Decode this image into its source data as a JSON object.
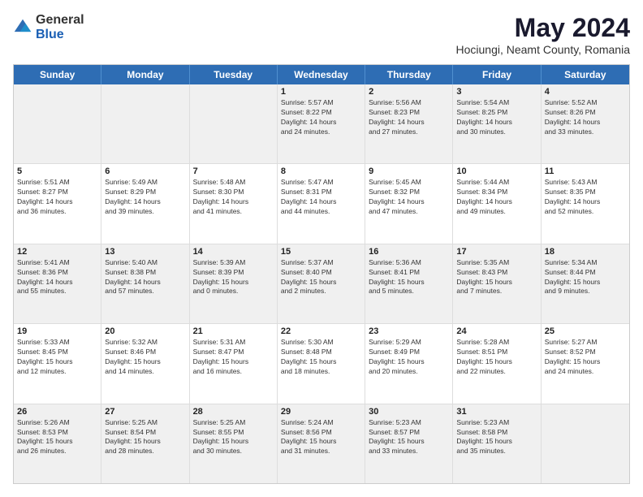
{
  "logo": {
    "general": "General",
    "blue": "Blue"
  },
  "header": {
    "month_year": "May 2024",
    "location": "Hociungi, Neamt County, Romania"
  },
  "weekdays": [
    "Sunday",
    "Monday",
    "Tuesday",
    "Wednesday",
    "Thursday",
    "Friday",
    "Saturday"
  ],
  "rows": [
    [
      {
        "day": "",
        "info": ""
      },
      {
        "day": "",
        "info": ""
      },
      {
        "day": "",
        "info": ""
      },
      {
        "day": "1",
        "info": "Sunrise: 5:57 AM\nSunset: 8:22 PM\nDaylight: 14 hours\nand 24 minutes."
      },
      {
        "day": "2",
        "info": "Sunrise: 5:56 AM\nSunset: 8:23 PM\nDaylight: 14 hours\nand 27 minutes."
      },
      {
        "day": "3",
        "info": "Sunrise: 5:54 AM\nSunset: 8:25 PM\nDaylight: 14 hours\nand 30 minutes."
      },
      {
        "day": "4",
        "info": "Sunrise: 5:52 AM\nSunset: 8:26 PM\nDaylight: 14 hours\nand 33 minutes."
      }
    ],
    [
      {
        "day": "5",
        "info": "Sunrise: 5:51 AM\nSunset: 8:27 PM\nDaylight: 14 hours\nand 36 minutes."
      },
      {
        "day": "6",
        "info": "Sunrise: 5:49 AM\nSunset: 8:29 PM\nDaylight: 14 hours\nand 39 minutes."
      },
      {
        "day": "7",
        "info": "Sunrise: 5:48 AM\nSunset: 8:30 PM\nDaylight: 14 hours\nand 41 minutes."
      },
      {
        "day": "8",
        "info": "Sunrise: 5:47 AM\nSunset: 8:31 PM\nDaylight: 14 hours\nand 44 minutes."
      },
      {
        "day": "9",
        "info": "Sunrise: 5:45 AM\nSunset: 8:32 PM\nDaylight: 14 hours\nand 47 minutes."
      },
      {
        "day": "10",
        "info": "Sunrise: 5:44 AM\nSunset: 8:34 PM\nDaylight: 14 hours\nand 49 minutes."
      },
      {
        "day": "11",
        "info": "Sunrise: 5:43 AM\nSunset: 8:35 PM\nDaylight: 14 hours\nand 52 minutes."
      }
    ],
    [
      {
        "day": "12",
        "info": "Sunrise: 5:41 AM\nSunset: 8:36 PM\nDaylight: 14 hours\nand 55 minutes."
      },
      {
        "day": "13",
        "info": "Sunrise: 5:40 AM\nSunset: 8:38 PM\nDaylight: 14 hours\nand 57 minutes."
      },
      {
        "day": "14",
        "info": "Sunrise: 5:39 AM\nSunset: 8:39 PM\nDaylight: 15 hours\nand 0 minutes."
      },
      {
        "day": "15",
        "info": "Sunrise: 5:37 AM\nSunset: 8:40 PM\nDaylight: 15 hours\nand 2 minutes."
      },
      {
        "day": "16",
        "info": "Sunrise: 5:36 AM\nSunset: 8:41 PM\nDaylight: 15 hours\nand 5 minutes."
      },
      {
        "day": "17",
        "info": "Sunrise: 5:35 AM\nSunset: 8:43 PM\nDaylight: 15 hours\nand 7 minutes."
      },
      {
        "day": "18",
        "info": "Sunrise: 5:34 AM\nSunset: 8:44 PM\nDaylight: 15 hours\nand 9 minutes."
      }
    ],
    [
      {
        "day": "19",
        "info": "Sunrise: 5:33 AM\nSunset: 8:45 PM\nDaylight: 15 hours\nand 12 minutes."
      },
      {
        "day": "20",
        "info": "Sunrise: 5:32 AM\nSunset: 8:46 PM\nDaylight: 15 hours\nand 14 minutes."
      },
      {
        "day": "21",
        "info": "Sunrise: 5:31 AM\nSunset: 8:47 PM\nDaylight: 15 hours\nand 16 minutes."
      },
      {
        "day": "22",
        "info": "Sunrise: 5:30 AM\nSunset: 8:48 PM\nDaylight: 15 hours\nand 18 minutes."
      },
      {
        "day": "23",
        "info": "Sunrise: 5:29 AM\nSunset: 8:49 PM\nDaylight: 15 hours\nand 20 minutes."
      },
      {
        "day": "24",
        "info": "Sunrise: 5:28 AM\nSunset: 8:51 PM\nDaylight: 15 hours\nand 22 minutes."
      },
      {
        "day": "25",
        "info": "Sunrise: 5:27 AM\nSunset: 8:52 PM\nDaylight: 15 hours\nand 24 minutes."
      }
    ],
    [
      {
        "day": "26",
        "info": "Sunrise: 5:26 AM\nSunset: 8:53 PM\nDaylight: 15 hours\nand 26 minutes."
      },
      {
        "day": "27",
        "info": "Sunrise: 5:25 AM\nSunset: 8:54 PM\nDaylight: 15 hours\nand 28 minutes."
      },
      {
        "day": "28",
        "info": "Sunrise: 5:25 AM\nSunset: 8:55 PM\nDaylight: 15 hours\nand 30 minutes."
      },
      {
        "day": "29",
        "info": "Sunrise: 5:24 AM\nSunset: 8:56 PM\nDaylight: 15 hours\nand 31 minutes."
      },
      {
        "day": "30",
        "info": "Sunrise: 5:23 AM\nSunset: 8:57 PM\nDaylight: 15 hours\nand 33 minutes."
      },
      {
        "day": "31",
        "info": "Sunrise: 5:23 AM\nSunset: 8:58 PM\nDaylight: 15 hours\nand 35 minutes."
      },
      {
        "day": "",
        "info": ""
      }
    ]
  ],
  "shaded_rows": [
    0,
    2,
    4
  ],
  "shaded_cells_row0": [
    0,
    1,
    2
  ],
  "shaded_cells_row4": [
    6
  ]
}
